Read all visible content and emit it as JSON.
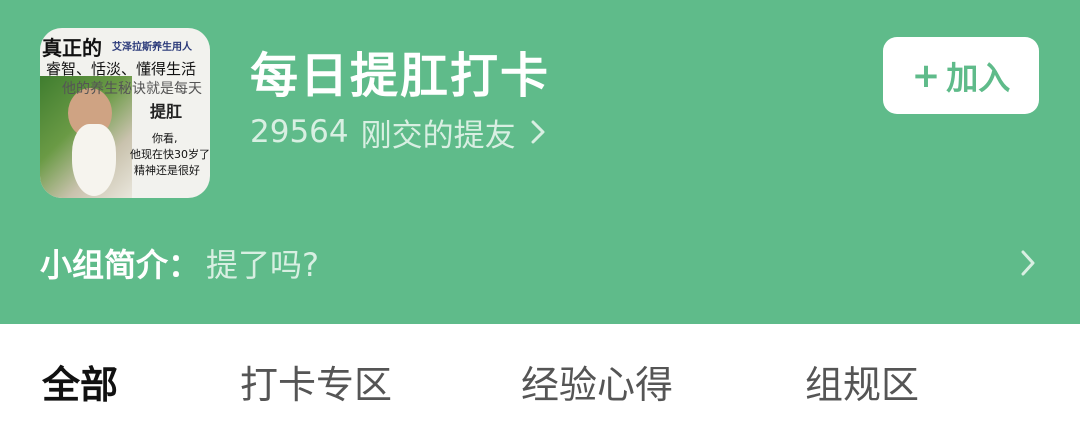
{
  "group": {
    "title": "每日提肛打卡",
    "member_count": "29564",
    "member_label": "刚交的提友",
    "join_label": "加入",
    "join_icon": "+",
    "intro_label": "小组简介：",
    "intro_text": "提了吗?",
    "avatar": {
      "line1": "真正的",
      "line2": "艾泽拉斯养生用人",
      "line3": "睿智、恬淡、懂得生活",
      "line4": "他的养生秘诀就是每天",
      "line5": "提肛",
      "line6": "你看,",
      "line7": "他现在快30岁了",
      "line8": "精神还是很好"
    }
  },
  "tabs": [
    {
      "label": "全部",
      "active": true
    },
    {
      "label": "打卡专区",
      "active": false
    },
    {
      "label": "经验心得",
      "active": false
    },
    {
      "label": "组规区",
      "active": false
    }
  ],
  "colors": {
    "header_bg": "#5fbb8a",
    "accent": "#5fbb8a",
    "subtext": "#d8efe2"
  }
}
